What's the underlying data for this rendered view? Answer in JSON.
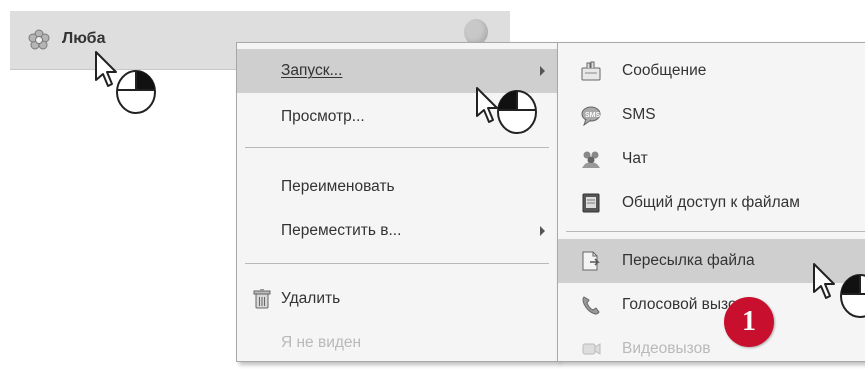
{
  "header": {
    "caption": ""
  },
  "contact": {
    "name": "Люба"
  },
  "context_menu": {
    "items": [
      {
        "label": "Запуск...",
        "has_submenu": true,
        "highlighted": true
      },
      {
        "label": "Просмотр..."
      },
      {
        "label": "Переименовать"
      },
      {
        "label": "Переместить в...",
        "has_submenu": true
      },
      {
        "label": "Удалить",
        "icon": "trash-icon"
      },
      {
        "label": "Я не виден",
        "disabled": true
      }
    ]
  },
  "submenu": {
    "items": [
      {
        "label": "Сообщение",
        "icon": "message-icon"
      },
      {
        "label": "SMS",
        "icon": "sms-icon"
      },
      {
        "label": "Чат",
        "icon": "chat-icon"
      },
      {
        "label": "Общий доступ к файлам",
        "icon": "shared-files-icon"
      },
      {
        "label": "Пересылка файла",
        "icon": "file-transfer-icon",
        "highlighted": true
      },
      {
        "label": "Голосовой вызов",
        "icon": "phone-icon"
      },
      {
        "label": "Видеовызов",
        "icon": "video-call-icon",
        "disabled": true
      }
    ]
  },
  "annotation": {
    "step_number": "1"
  },
  "colors": {
    "highlight": "#cfcfcf",
    "badge": "#c8102e",
    "menu_bg": "#f5f5f5"
  }
}
